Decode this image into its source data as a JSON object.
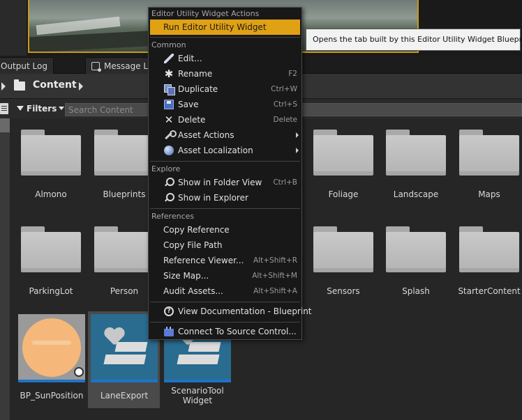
{
  "tooltip": {
    "text": "Opens the tab built by this Editor Utility Widget Blueprint."
  },
  "tabs": [
    {
      "label": "Output Log"
    },
    {
      "label": "Message Log"
    }
  ],
  "path": {
    "label": "Content"
  },
  "filters": {
    "label": "Filters",
    "search_placeholder": "Search Content"
  },
  "folders": {
    "almono": "Almono",
    "blueprints": "Blueprints",
    "foliage": "Foliage",
    "landscape": "Landscape",
    "maps": "Maps",
    "parkinglot": "ParkingLot",
    "person": "Person",
    "sensors": "Sensors",
    "splash": "Splash",
    "startercontent": "StarterContent"
  },
  "assets": {
    "sun": "BP_SunPosition",
    "lane": "LaneExport",
    "scenario": "ScenarioTool Widget"
  },
  "menu": {
    "header_actions": "Editor Utility Widget Actions",
    "run": "Run Editor Utility Widget",
    "header_common": "Common",
    "edit": "Edit...",
    "rename": "Rename",
    "rename_sc": "F2",
    "duplicate": "Duplicate",
    "duplicate_sc": "Ctrl+W",
    "save": "Save",
    "save_sc": "Ctrl+S",
    "delete": "Delete",
    "delete_sc": "Delete",
    "asset_actions": "Asset Actions",
    "asset_localization": "Asset Localization",
    "header_explore": "Explore",
    "show_folder": "Show in Folder View",
    "show_folder_sc": "Ctrl+B",
    "show_explorer": "Show in Explorer",
    "header_refs": "References",
    "copy_ref": "Copy Reference",
    "copy_path": "Copy File Path",
    "ref_viewer": "Reference Viewer...",
    "ref_viewer_sc": "Alt+Shift+R",
    "size_map": "Size Map...",
    "size_map_sc": "Alt+Shift+M",
    "audit": "Audit Assets...",
    "audit_sc": "Alt+Shift+A",
    "view_docs": "View Documentation - Blueprint",
    "source_control": "Connect To Source Control..."
  }
}
